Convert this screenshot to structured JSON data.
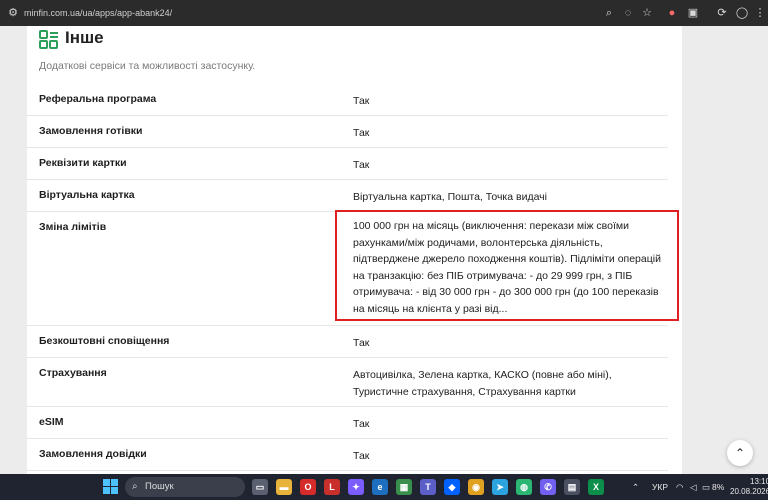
{
  "browser": {
    "url": "minfin.com.ua/ua/apps/app-abank24/"
  },
  "section": {
    "title": "Інше",
    "subtitle": "Додаткові сервіси та можливості застосунку."
  },
  "rows": [
    {
      "label": "Реферальна програма",
      "value": "Так"
    },
    {
      "label": "Замовлення готівки",
      "value": "Так"
    },
    {
      "label": "Реквізити картки",
      "value": "Так"
    },
    {
      "label": "Віртуальна картка",
      "value": "Віртуальна картка, Пошта, Точка видачі"
    },
    {
      "label": "Зміна лімітів",
      "value": "100 000 грн на місяць (виключення: перекази між своїми рахунками/між родичами, волонтерська діяльність, підтверджене джерело походження коштів). Підліміти операцій на транзакцію: без ПІБ отримувача: - до 29 999 грн, з ПІБ отримувача: - від 30 000 грн - до 300 000 грн (до 100 переказів на місяць на клієнта у разі від..."
    },
    {
      "label": "Безкоштовні сповіщення",
      "value": "Так"
    },
    {
      "label": "Страхування",
      "value": "Автоцивілка, Зелена картка, КАСКО (повне або міні), Туристичне страхування, Страхування картки"
    },
    {
      "label": "eSIM",
      "value": "Так"
    },
    {
      "label": "Замовлення довідки",
      "value": "Так"
    }
  ],
  "taskbar": {
    "search_label": "Пошук",
    "language": "УКР",
    "battery": "8%",
    "time": "13:10",
    "date": "20.08.2026"
  },
  "colors": {
    "accent_green": "#2e9e5b",
    "highlight_red": "#e02020",
    "taskbar_bg": "#1f2430"
  },
  "icons": [
    "site-info-icon",
    "search-icon",
    "eye-off-icon",
    "star-icon",
    "extensions-icon",
    "profile-icon",
    "menu-icon",
    "grid-icon",
    "scroll-up-icon"
  ]
}
